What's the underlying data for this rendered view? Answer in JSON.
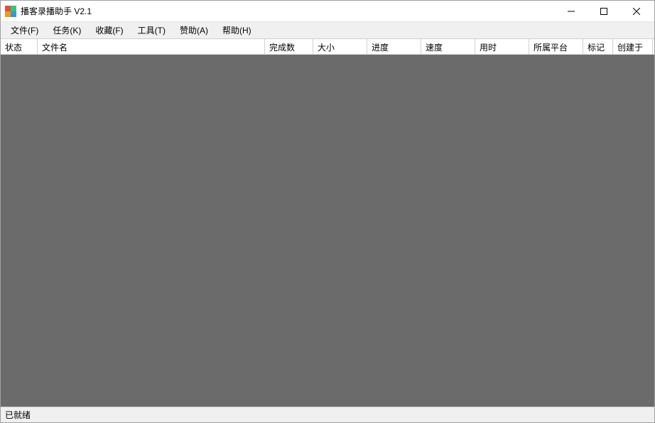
{
  "window": {
    "title": "播客录播助手 V2.1"
  },
  "menu": {
    "file": "文件(F)",
    "task": "任务(K)",
    "favorite": "收藏(F)",
    "tool": "工具(T)",
    "sponsor": "赞助(A)",
    "help": "帮助(H)"
  },
  "columns": {
    "status": "状态",
    "filename": "文件名",
    "completed": "完成数",
    "size": "大小",
    "progress": "进度",
    "speed": "速度",
    "elapsed": "用时",
    "platform": "所属平台",
    "mark": "标记",
    "created": "创建于"
  },
  "columnWidths": {
    "status": 52,
    "filename": 320,
    "completed": 68,
    "size": 76,
    "progress": 76,
    "speed": 76,
    "elapsed": 76,
    "platform": 76,
    "mark": 42,
    "created": 56
  },
  "status": {
    "text": "已就绪"
  }
}
